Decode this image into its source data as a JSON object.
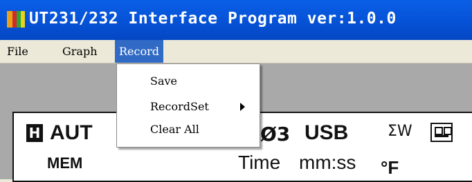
{
  "window": {
    "title": "UT231/232 Interface Program ver:1.0.0",
    "icon": "app-icon"
  },
  "menubar": {
    "items": [
      {
        "label": "File"
      },
      {
        "label": "Graph"
      },
      {
        "label": "Record"
      }
    ]
  },
  "record_menu": {
    "items": [
      {
        "label": "Save"
      },
      {
        "label": "RecordSet"
      },
      {
        "label": "Clear All"
      }
    ]
  },
  "display": {
    "h_badge": "H",
    "auto": "AUT",
    "mem": "MEM",
    "phase": "Ø3",
    "usb": "USB",
    "sigma_w": "ΣW",
    "time": "Time",
    "mmss": "mm:ss",
    "degree_f": "°F",
    "battery_icon": "battery-icon"
  },
  "colors": {
    "titlebar": "#0653d8",
    "menu_highlight": "#316ac5",
    "workarea": "#a9a9a9"
  }
}
